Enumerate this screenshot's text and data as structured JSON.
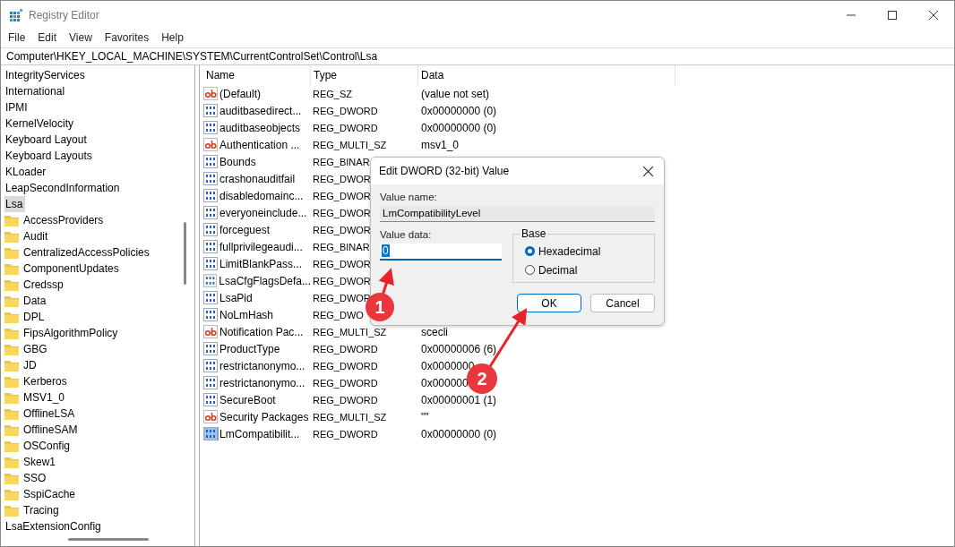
{
  "window": {
    "title": "Registry Editor"
  },
  "menu": [
    "File",
    "Edit",
    "View",
    "Favorites",
    "Help"
  ],
  "address": "Computer\\HKEY_LOCAL_MACHINE\\SYSTEM\\CurrentControlSet\\Control\\Lsa",
  "tree": [
    {
      "label": "IntegrityServices",
      "selected": false
    },
    {
      "label": "International",
      "selected": false
    },
    {
      "label": "IPMI",
      "selected": false
    },
    {
      "label": "KernelVelocity",
      "selected": false
    },
    {
      "label": "Keyboard Layout",
      "selected": false
    },
    {
      "label": "Keyboard Layouts",
      "selected": false
    },
    {
      "label": "KLoader",
      "selected": false
    },
    {
      "label": "LeapSecondInformation",
      "selected": false
    },
    {
      "label": "Lsa",
      "selected": true,
      "children": [
        {
          "label": "AccessProviders",
          "selected": false
        },
        {
          "label": "Audit",
          "selected": false
        },
        {
          "label": "CentralizedAccessPolicies",
          "selected": false
        },
        {
          "label": "ComponentUpdates",
          "selected": false
        },
        {
          "label": "Credssp",
          "selected": false
        },
        {
          "label": "Data",
          "selected": false
        },
        {
          "label": "DPL",
          "selected": false
        },
        {
          "label": "FipsAlgorithmPolicy",
          "selected": false
        },
        {
          "label": "GBG",
          "selected": false
        },
        {
          "label": "JD",
          "selected": false
        },
        {
          "label": "Kerberos",
          "selected": false
        },
        {
          "label": "MSV1_0",
          "selected": false
        },
        {
          "label": "OfflineLSA",
          "selected": false
        },
        {
          "label": "OfflineSAM",
          "selected": false
        },
        {
          "label": "OSConfig",
          "selected": false
        },
        {
          "label": "Skew1",
          "selected": false
        },
        {
          "label": "SSO",
          "selected": false
        },
        {
          "label": "SspiCache",
          "selected": false
        },
        {
          "label": "Tracing",
          "selected": false
        }
      ]
    },
    {
      "label": "LsaExtensionConfig",
      "selected": false
    }
  ],
  "table": {
    "columns": [
      "Name",
      "Type",
      "Data"
    ],
    "rows": [
      {
        "kind": "string",
        "name": "(Default)",
        "type": "REG_SZ",
        "data": "(value not set)",
        "selected": false
      },
      {
        "kind": "binary",
        "name": "auditbasedirect...",
        "type": "REG_DWORD",
        "data": "0x00000000 (0)",
        "selected": false
      },
      {
        "kind": "binary",
        "name": "auditbaseobjects",
        "type": "REG_DWORD",
        "data": "0x00000000 (0)",
        "selected": false
      },
      {
        "kind": "string",
        "name": "Authentication ...",
        "type": "REG_MULTI_SZ",
        "data": "msv1_0",
        "selected": false
      },
      {
        "kind": "binary",
        "name": "Bounds",
        "type": "REG_BINAR",
        "selected": false
      },
      {
        "kind": "binary",
        "name": "crashonauditfail",
        "type": "REG_DWOR",
        "selected": false
      },
      {
        "kind": "binary",
        "name": "disabledomainc...",
        "type": "REG_DWOR",
        "selected": false
      },
      {
        "kind": "binary",
        "name": "everyoneinclude...",
        "type": "REG_DWOR",
        "selected": false
      },
      {
        "kind": "binary",
        "name": "forceguest",
        "type": "REG_DWOR",
        "selected": false
      },
      {
        "kind": "binary",
        "name": "fullprivilegeaudi...",
        "type": "REG_BINAR",
        "selected": false
      },
      {
        "kind": "binary",
        "name": "LimitBlankPass...",
        "type": "REG_DWOR",
        "selected": false
      },
      {
        "kind": "binary",
        "name": "LsaCfgFlagsDefa...",
        "type": "REG_DWOR",
        "selected": false
      },
      {
        "kind": "binary",
        "name": "LsaPid",
        "type": "REG_DWOR",
        "selected": false
      },
      {
        "kind": "binary",
        "name": "NoLmHash",
        "type": "REG_DWO",
        "selected": false
      },
      {
        "kind": "string",
        "name": "Notification Pac...",
        "type": "REG_MULTI_SZ",
        "data": "scecli",
        "selected": false
      },
      {
        "kind": "binary",
        "name": "ProductType",
        "type": "REG_DWORD",
        "data": "0x00000006 (6)",
        "selected": false
      },
      {
        "kind": "binary",
        "name": "restrictanonymo...",
        "type": "REG_DWORD",
        "data": "0x0000000",
        "selected": false
      },
      {
        "kind": "binary",
        "name": "restrictanonymo...",
        "type": "REG_DWORD",
        "data": "0x000000",
        "selected": false
      },
      {
        "kind": "binary",
        "name": "SecureBoot",
        "type": "REG_DWORD",
        "data": "0x00000001 (1)",
        "selected": false
      },
      {
        "kind": "string",
        "name": "Security Packages",
        "type": "REG_MULTI_SZ",
        "data": "\"\"",
        "selected": false
      },
      {
        "kind": "binary",
        "name": "LmCompatibilit...",
        "type": "REG_DWORD",
        "data": "0x00000000 (0)",
        "selected": true
      }
    ]
  },
  "dialog": {
    "title": "Edit DWORD (32-bit) Value",
    "name_label": "Value name:",
    "name_value": "LmCompatibilityLevel",
    "data_label": "Value data:",
    "data_value": "0",
    "base_label": "Base",
    "base_options": [
      {
        "label": "Hexadecimal",
        "selected": true
      },
      {
        "label": "Decimal",
        "selected": false
      }
    ],
    "buttons": [
      {
        "label": "OK",
        "kind": "primary"
      },
      {
        "label": "Cancel",
        "kind": "secondary"
      }
    ]
  },
  "annotations": [
    "1",
    "2"
  ]
}
